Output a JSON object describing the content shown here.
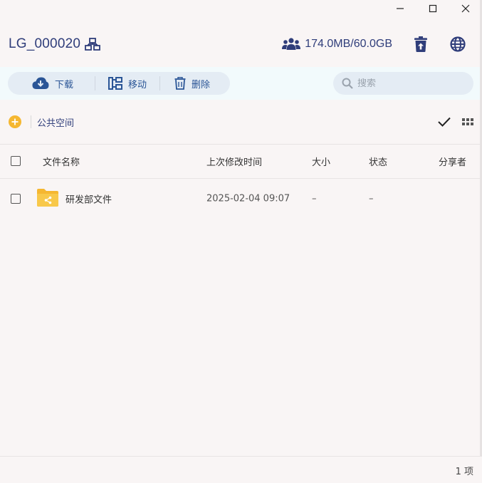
{
  "window": {
    "controls": [
      "minimize",
      "maximize",
      "close"
    ]
  },
  "header": {
    "title": "LG_000020",
    "storage": "174.0MB/60.0GB",
    "colors": {
      "title": "#2f3d7a"
    }
  },
  "toolbar": {
    "download_label": "下载",
    "move_label": "移动",
    "delete_label": "删除",
    "search_placeholder": "搜索"
  },
  "breadcrumb": {
    "current": "公共空间"
  },
  "table": {
    "columns": {
      "name": "文件名称",
      "modified": "上次修改时间",
      "size": "大小",
      "status": "状态",
      "sharer": "分享者"
    },
    "rows": [
      {
        "name": "研发部文件",
        "modified": "2025-02-04 09:07",
        "size": "–",
        "status": "–",
        "sharer": ""
      }
    ]
  },
  "footer": {
    "count": "1 项"
  }
}
